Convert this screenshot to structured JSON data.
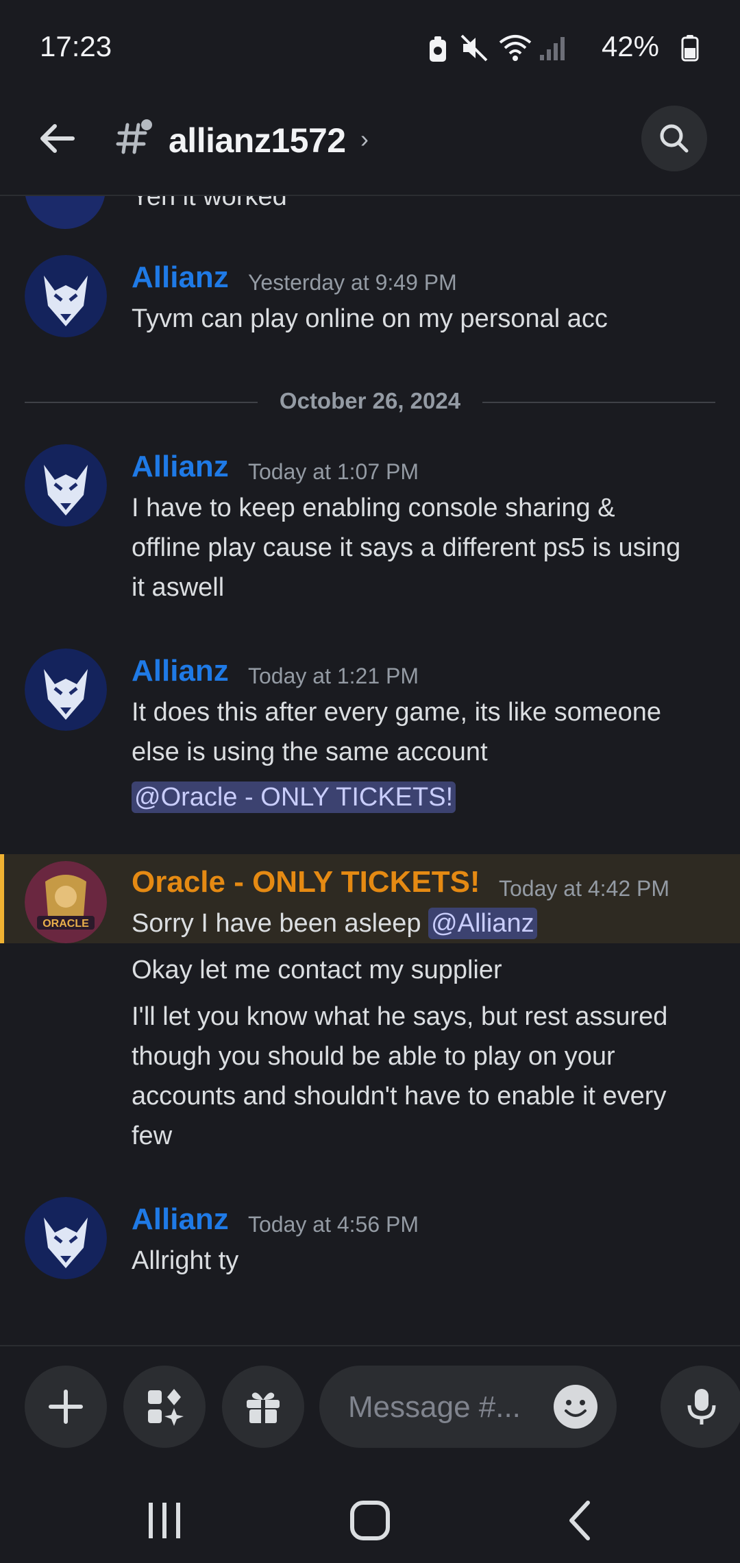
{
  "status": {
    "time": "17:23",
    "battery": "42%"
  },
  "header": {
    "channel": "allianz1572"
  },
  "partial_message": "Yeh it worked",
  "messages": [
    {
      "author": "Allianz",
      "timestamp": "Yesterday at 9:49 PM",
      "lines": [
        "Tyvm can play online on my personal acc"
      ]
    },
    {
      "author": "Allianz",
      "timestamp": "Today at 1:07 PM",
      "lines": [
        "I have to keep enabling console sharing &",
        "offline play cause it says a different ps5 is using",
        "it aswell"
      ]
    },
    {
      "author": "Allianz",
      "timestamp": "Today at 1:21 PM",
      "lines": [
        "It does this after every game, its like someone",
        "else is using the same account"
      ],
      "mention": "@Oracle - ONLY TICKETS!"
    },
    {
      "author": "Oracle - ONLY TICKETS!",
      "timestamp": "Today at 4:42 PM",
      "line1_text": "Sorry I have been asleep ",
      "line1_mention": "@Allianz",
      "line2": "Okay let me contact my supplier",
      "line3": [
        "I'll let you know what he says, but rest assured",
        "though you should be able to play on your",
        "accounts and shouldn't have to enable it every",
        "few"
      ]
    },
    {
      "author": "Allianz",
      "timestamp": "Today at 4:56 PM",
      "lines": [
        "Allright ty"
      ]
    }
  ],
  "divider_date": "October 26, 2024",
  "composer": {
    "placeholder": "Message #..."
  },
  "oracle_badge_text": "ORACLE",
  "colors": {
    "accent_blue": "#1f7ae6",
    "oracle_orange": "#e58a13",
    "highlight_bar": "#f0b232",
    "background": "#1a1b20"
  },
  "icons": [
    "back-arrow-icon",
    "channel-hash-icon",
    "search-icon",
    "plus-icon",
    "apps-icon",
    "gift-icon",
    "emoji-icon",
    "mic-icon",
    "recents-icon",
    "home-icon",
    "nav-back-icon"
  ]
}
